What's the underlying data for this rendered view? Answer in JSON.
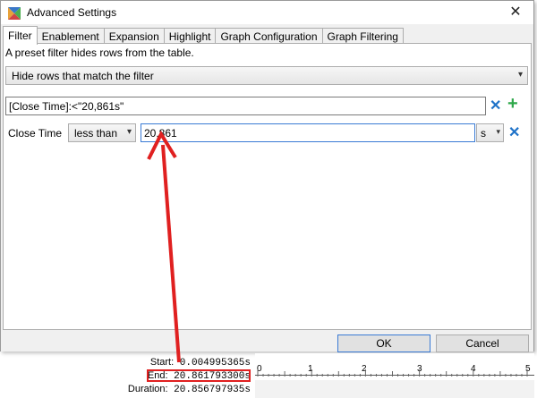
{
  "window": {
    "title": "Advanced Settings",
    "close_glyph": "✕"
  },
  "tabs": [
    {
      "label": "Filter",
      "active": true
    },
    {
      "label": "Enablement",
      "active": false
    },
    {
      "label": "Expansion",
      "active": false
    },
    {
      "label": "Highlight",
      "active": false
    },
    {
      "label": "Graph Configuration",
      "active": false
    },
    {
      "label": "Graph Filtering",
      "active": false
    }
  ],
  "filter": {
    "description": "A preset filter hides rows from the table.",
    "mode_selected": "Hide rows that match the filter",
    "expression_value": "[Close Time]:<\"20,861s\"",
    "condition": {
      "field_label": "Close Time",
      "operator_selected": "less than",
      "value": "20,861",
      "unit_selected": "s"
    },
    "remove_glyph": "✕",
    "add_glyph": "+"
  },
  "buttons": {
    "ok_label": "OK",
    "cancel_label": "Cancel"
  },
  "background": {
    "start_label": "Start:",
    "start_value": "0.004995365s",
    "end_label": "End:",
    "end_value": "20.861793300s",
    "duration_label": "Duration:",
    "duration_value": "20.856797935s",
    "ruler_ticks": [
      "0",
      "1",
      "2",
      "3",
      "4",
      "5"
    ]
  },
  "colors": {
    "accent_blue": "#1e72c8",
    "add_green": "#2ea84a",
    "annotation_red": "#e02020"
  }
}
